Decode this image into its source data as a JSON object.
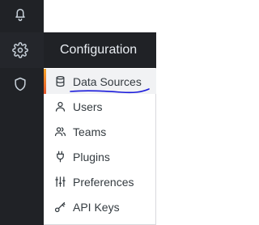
{
  "sidebar": {
    "icons": [
      {
        "name": "bell-icon"
      },
      {
        "name": "gear-icon",
        "active": true
      },
      {
        "name": "shield-icon"
      }
    ]
  },
  "menu": {
    "title": "Configuration",
    "items": [
      {
        "label": "Data Sources",
        "icon": "database-icon",
        "active": true
      },
      {
        "label": "Users",
        "icon": "user-icon"
      },
      {
        "label": "Teams",
        "icon": "users-icon"
      },
      {
        "label": "Plugins",
        "icon": "plug-icon"
      },
      {
        "label": "Preferences",
        "icon": "sliders-icon"
      },
      {
        "label": "API Keys",
        "icon": "key-icon"
      }
    ]
  },
  "colors": {
    "sidebar_bg": "#202226",
    "menu_header_text": "#e9edf2",
    "active_accent": "#f7a528",
    "annotation_stroke": "#1a1adb"
  }
}
